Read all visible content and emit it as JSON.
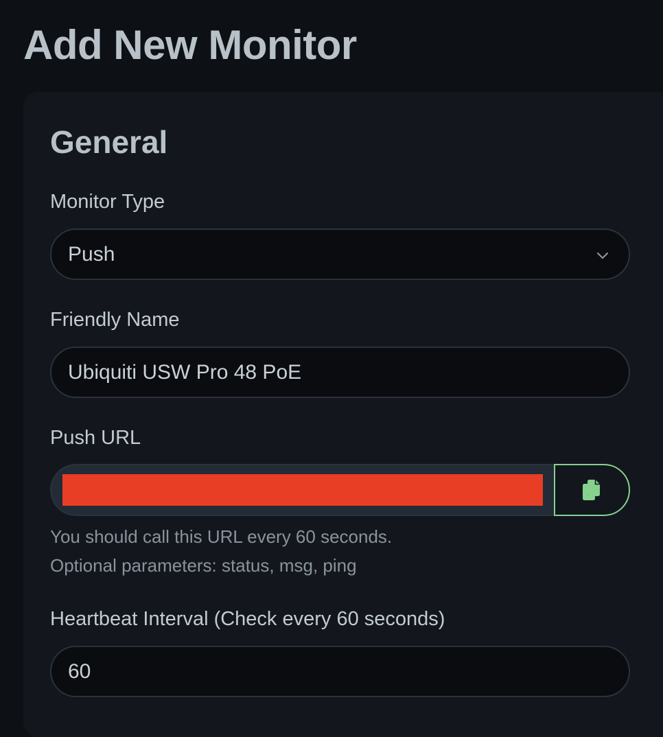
{
  "page": {
    "title": "Add New Monitor"
  },
  "general": {
    "section_title": "General",
    "monitor_type": {
      "label": "Monitor Type",
      "selected": "Push",
      "icon": "chevron-down-icon"
    },
    "friendly_name": {
      "label": "Friendly Name",
      "value": "Ubiquiti USW Pro 48 PoE"
    },
    "push_url": {
      "label": "Push URL",
      "copy_icon": "copy-icon",
      "redaction_color": "#e83e25",
      "hint_line1": "You should call this URL every 60 seconds.",
      "hint_line2": "Optional parameters: status, msg, ping"
    },
    "heartbeat_interval": {
      "label": "Heartbeat Interval (Check every 60 seconds)",
      "value": "60"
    }
  },
  "colors": {
    "background": "#0d1014",
    "card": "#13171d",
    "input_bg": "#0a0c0f",
    "accent_green": "#86d18e"
  }
}
